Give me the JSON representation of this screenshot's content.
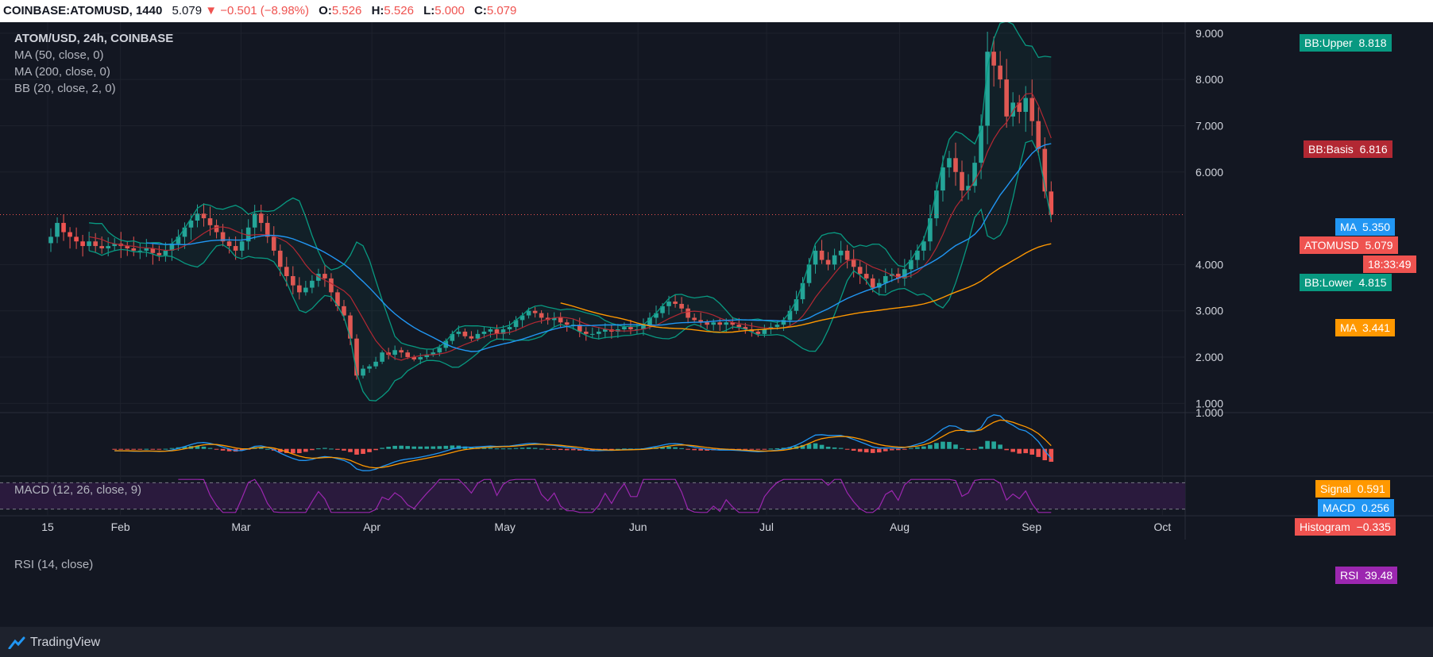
{
  "header": {
    "symbol": "COINBASE:ATOMUSD, 1440",
    "last": "5.079",
    "change": "−0.501 (−8.98%)",
    "o_label": "O:",
    "o": "5.526",
    "h_label": "H:",
    "h": "5.526",
    "l_label": "L:",
    "l": "5.000",
    "c_label": "C:",
    "c": "5.079"
  },
  "legend": {
    "title": "ATOM/USD, 24h, COINBASE",
    "ma50": "MA (50, close, 0)",
    "ma200": "MA (200, close, 0)",
    "bb": "BB (20, close, 2, 0)",
    "macd": "MACD (12, 26, close, 9)",
    "rsi": "RSI (14, close)"
  },
  "tags": {
    "bb_upper": "BB:Upper",
    "bb_upper_val": "8.818",
    "bb_basis": "BB:Basis",
    "bb_basis_val": "6.816",
    "ma_a": "MA",
    "ma_a_val": "5.350",
    "price": "ATOMUSD",
    "price_val": "5.079",
    "countdown": "18:33:49",
    "bb_lower": "BB:Lower",
    "bb_lower_val": "4.815",
    "ma_b": "MA",
    "ma_b_val": "3.441",
    "signal": "Signal",
    "signal_val": "0.591",
    "macd": "MACD",
    "macd_val": "0.256",
    "hist": "Histogram",
    "hist_val": "−0.335",
    "rsi": "RSI",
    "rsi_val": "39.48"
  },
  "footer": {
    "brand": "TradingView"
  },
  "colors": {
    "up": "#26a69a",
    "down": "#ef5350",
    "ma50": "#2196f3",
    "ma200": "#ff9800",
    "bb_band": "#089981",
    "bb_basis": "#b22833",
    "macd": "#2196f3",
    "signal": "#ff9800",
    "rsi": "#9c27b0",
    "rsi_bg": "#2a1a3d"
  },
  "chart_data": {
    "type": "candlestick",
    "title": "ATOM/USD, 24h, COINBASE",
    "x_ticks": [
      "15",
      "Feb",
      "Mar",
      "Apr",
      "May",
      "Jun",
      "Jul",
      "Aug",
      "Sep",
      "Oct"
    ],
    "y_ticks": [
      "1.000",
      "2.000",
      "3.000",
      "4.000",
      "6.000",
      "7.000",
      "8.000",
      "9.000"
    ],
    "ylim": [
      0.8,
      9.1
    ],
    "macd_ticks": [
      "1.000"
    ],
    "macd_ylim": [
      -0.75,
      1.0
    ],
    "rsi_ylim": [
      20,
      80
    ],
    "rsi_levels": [
      70,
      30
    ],
    "candle_count": 233,
    "close_series": [
      4.6,
      4.9,
      4.7,
      4.6,
      4.5,
      4.4,
      4.5,
      4.4,
      4.35,
      4.4,
      4.45,
      4.4,
      4.35,
      4.3,
      4.3,
      4.35,
      4.25,
      4.2,
      4.3,
      4.45,
      4.6,
      4.8,
      4.95,
      5.1,
      5.0,
      4.85,
      4.7,
      4.5,
      4.4,
      4.3,
      4.5,
      4.8,
      5.1,
      4.9,
      4.6,
      4.3,
      3.95,
      3.75,
      3.55,
      3.4,
      3.5,
      3.65,
      3.8,
      3.7,
      3.4,
      3.1,
      2.9,
      2.4,
      1.6,
      1.75,
      1.8,
      1.9,
      2.1,
      2.05,
      2.15,
      2.1,
      2.0,
      1.95,
      2.0,
      2.05,
      2.1,
      2.2,
      2.35,
      2.5,
      2.55,
      2.45,
      2.4,
      2.5,
      2.55,
      2.6,
      2.5,
      2.6,
      2.65,
      2.8,
      2.9,
      3.0,
      2.95,
      2.85,
      2.8,
      2.85,
      2.75,
      2.7,
      2.7,
      2.55,
      2.5,
      2.5,
      2.55,
      2.6,
      2.55,
      2.6,
      2.65,
      2.6,
      2.6,
      2.7,
      2.85,
      2.95,
      3.1,
      3.2,
      3.15,
      3.05,
      2.85,
      2.8,
      2.75,
      2.7,
      2.75,
      2.7,
      2.75,
      2.7,
      2.65,
      2.6,
      2.55,
      2.5,
      2.6,
      2.65,
      2.7,
      2.8,
      3.0,
      3.25,
      3.6,
      4.0,
      4.3,
      4.1,
      4.0,
      4.2,
      4.3,
      4.1,
      3.95,
      3.8,
      3.7,
      3.5,
      3.6,
      3.75,
      3.8,
      3.7,
      3.9,
      4.1,
      4.3,
      4.5,
      5.0,
      5.6,
      6.1,
      6.3,
      6.0,
      5.6,
      5.7,
      6.2,
      7.0,
      8.6,
      8.3,
      8.0,
      7.2,
      7.5,
      7.3,
      7.6,
      7.1,
      6.5,
      5.579,
      5.079
    ],
    "macd_series_note": "MACD 0.256, Signal 0.591, Histogram −0.335 at last bar",
    "last_values": {
      "close": 5.079,
      "open": 5.526,
      "high": 5.526,
      "low": 5.0,
      "bb_upper": 8.818,
      "bb_basis": 6.816,
      "bb_lower": 4.815,
      "ma50": 5.35,
      "ma200": 3.441,
      "macd": 0.256,
      "signal": 0.591,
      "histogram": -0.335,
      "rsi": 39.48
    }
  }
}
